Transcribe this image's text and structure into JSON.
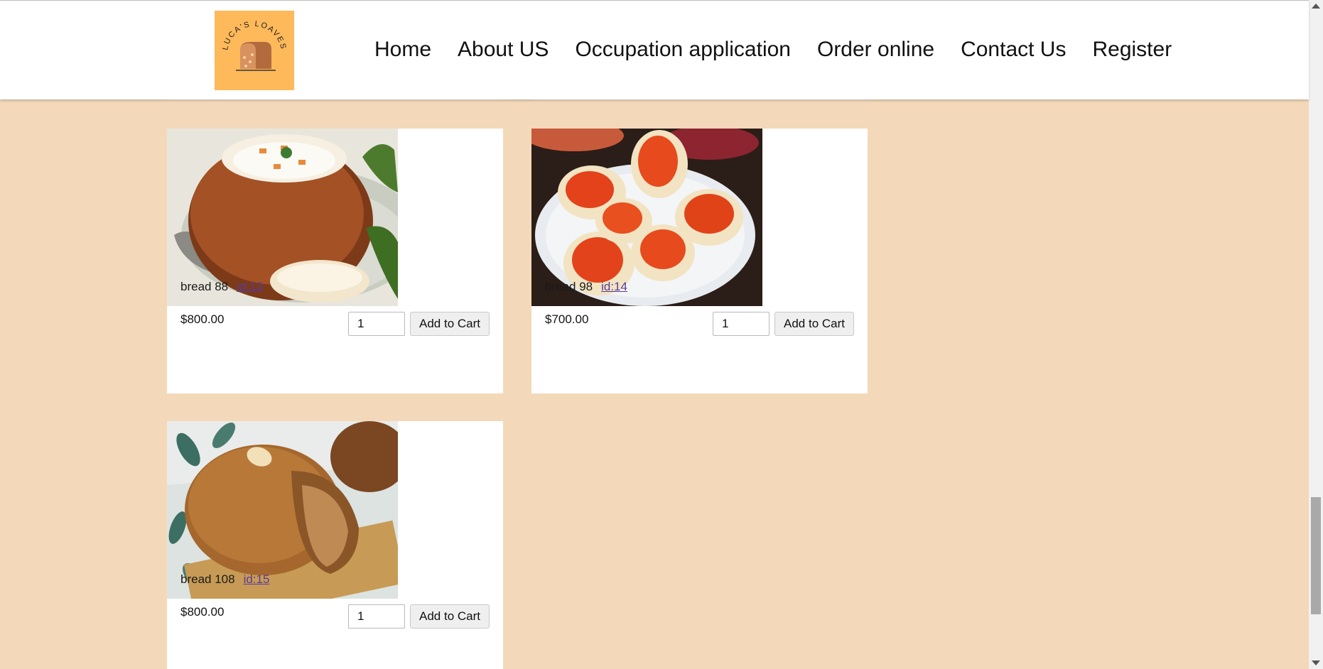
{
  "logo": {
    "text": "LUCA'S LOAVES",
    "color": "#fdb95a"
  },
  "nav": {
    "items": [
      "Home",
      "About US",
      "Occupation application",
      "Order online",
      "Contact Us",
      "Register"
    ]
  },
  "products": [
    {
      "name": "bread 88",
      "id_label": "id:13",
      "price": "$800.00",
      "qty": "1",
      "button": "Add to Cart",
      "image": "bread-bowl-soup"
    },
    {
      "name": "bread 98",
      "id_label": "id:14",
      "price": "$700.00",
      "qty": "1",
      "button": "Add to Cart",
      "image": "caviar-toasts"
    },
    {
      "name": "bread 108",
      "id_label": "id:15",
      "price": "$800.00",
      "qty": "1",
      "button": "Add to Cart",
      "image": "brown-buns"
    }
  ],
  "colors": {
    "page_background": "#f3d9b9",
    "card": "#ffffff",
    "link": "#5a3c98"
  }
}
